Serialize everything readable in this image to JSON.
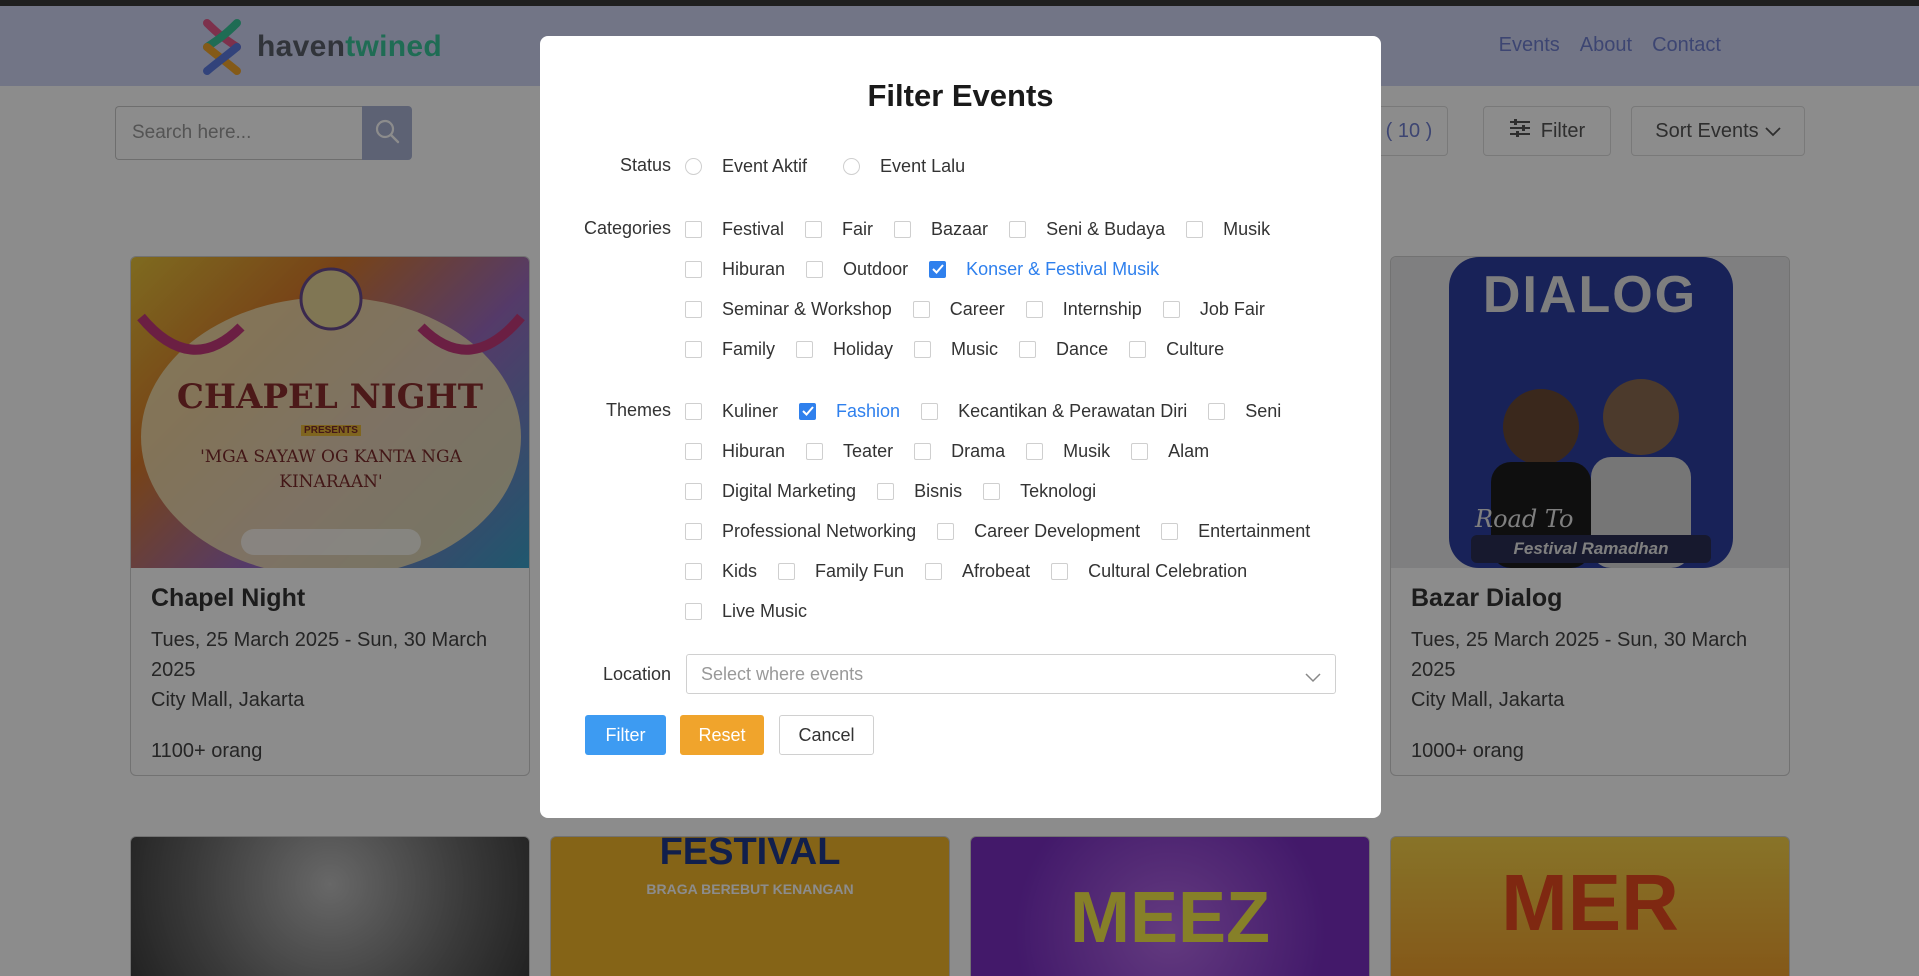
{
  "brand": {
    "part1": "haven",
    "part2": "twined",
    "accent": "#39c59a"
  },
  "nav": {
    "links": [
      "Events",
      "About",
      "Contact"
    ]
  },
  "search": {
    "placeholder": "Search here..."
  },
  "toolbar": {
    "count": "( 10 )",
    "filter_label": "Filter",
    "sort_label": "Sort Events"
  },
  "cards": [
    {
      "title": "Chapel Night",
      "date": "Tues, 25 March 2025 - Sun, 30 March 2025",
      "location": "City Mall, Jakarta",
      "people": "1100+ orang",
      "poster_title": "CHAPEL NIGHT",
      "poster_presents": "PRESENTS",
      "poster_subtitle": "'MGA SAYAW OG KANTA NGA KINARAAN'"
    },
    {
      "title": "Bazar Dialog",
      "date": "Tues, 25 March 2025 - Sun, 30 March 2025",
      "location": "City Mall, Jakarta",
      "people": "1000+ orang",
      "poster_title": "DIALOG",
      "poster_road": "Road To",
      "poster_banner": "Festival Ramadhan"
    }
  ],
  "cards_row2": [
    {
      "poster_text": ""
    },
    {
      "poster_text": "FESTIVAL",
      "poster_sub": "BRAGA BEREBUT KENANGAN"
    },
    {
      "poster_text": "MEEZ"
    },
    {
      "poster_text": "MER"
    }
  ],
  "modal": {
    "title": "Filter Events",
    "status": {
      "label": "Status",
      "options": [
        {
          "label": "Event Aktif",
          "selected": false
        },
        {
          "label": "Event Lalu",
          "selected": false
        }
      ]
    },
    "categories": {
      "label": "Categories",
      "rows": [
        [
          {
            "label": "Festival",
            "checked": false
          },
          {
            "label": "Fair",
            "checked": false
          },
          {
            "label": "Bazaar",
            "checked": false
          },
          {
            "label": "Seni & Budaya",
            "checked": false
          },
          {
            "label": "Musik",
            "checked": false
          }
        ],
        [
          {
            "label": "Hiburan",
            "checked": false
          },
          {
            "label": "Outdoor",
            "checked": false
          },
          {
            "label": "Konser & Festival Musik",
            "checked": true
          }
        ],
        [
          {
            "label": "Seminar & Workshop",
            "checked": false
          },
          {
            "label": "Career",
            "checked": false
          },
          {
            "label": "Internship",
            "checked": false
          },
          {
            "label": "Job Fair",
            "checked": false
          }
        ],
        [
          {
            "label": "Family",
            "checked": false
          },
          {
            "label": "Holiday",
            "checked": false
          },
          {
            "label": "Music",
            "checked": false
          },
          {
            "label": "Dance",
            "checked": false
          },
          {
            "label": "Culture",
            "checked": false
          }
        ]
      ]
    },
    "themes": {
      "label": "Themes",
      "rows": [
        [
          {
            "label": "Kuliner",
            "checked": false
          },
          {
            "label": "Fashion",
            "checked": true
          },
          {
            "label": "Kecantikan & Perawatan Diri",
            "checked": false
          },
          {
            "label": "Seni",
            "checked": false
          }
        ],
        [
          {
            "label": "Hiburan",
            "checked": false
          },
          {
            "label": "Teater",
            "checked": false
          },
          {
            "label": "Drama",
            "checked": false
          },
          {
            "label": "Musik",
            "checked": false
          },
          {
            "label": "Alam",
            "checked": false
          }
        ],
        [
          {
            "label": "Digital Marketing",
            "checked": false
          },
          {
            "label": "Bisnis",
            "checked": false
          },
          {
            "label": "Teknologi",
            "checked": false
          }
        ],
        [
          {
            "label": "Professional Networking",
            "checked": false
          },
          {
            "label": "Career Development",
            "checked": false
          },
          {
            "label": "Entertainment",
            "checked": false
          }
        ],
        [
          {
            "label": "Kids",
            "checked": false
          },
          {
            "label": "Family Fun",
            "checked": false
          },
          {
            "label": "Afrobeat",
            "checked": false
          },
          {
            "label": "Cultural Celebration",
            "checked": false
          }
        ],
        [
          {
            "label": "Live Music",
            "checked": false
          }
        ]
      ]
    },
    "location": {
      "label": "Location",
      "placeholder": "Select where events"
    },
    "buttons": {
      "filter": "Filter",
      "reset": "Reset",
      "cancel": "Cancel"
    }
  },
  "colors": {
    "primary": "#3d9bf2",
    "check": "#2f80ed",
    "reset": "#f0a42c",
    "navbar": "#cfd6f4"
  }
}
